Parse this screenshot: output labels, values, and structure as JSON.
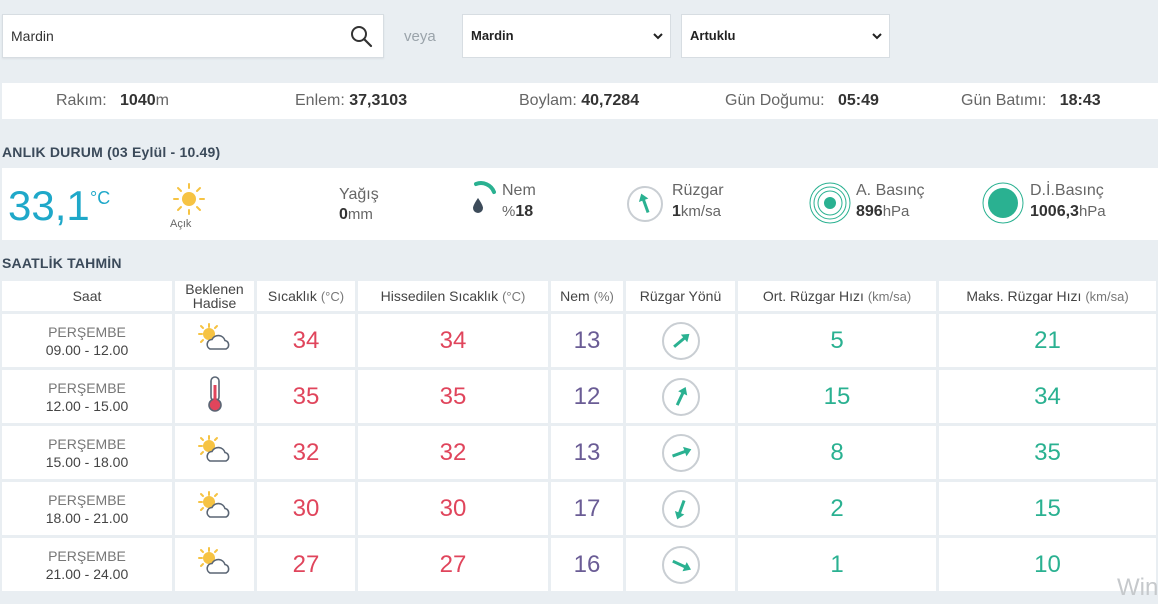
{
  "search": {
    "value": "Mardin",
    "placeholder": ""
  },
  "or_label": "veya",
  "province_select": {
    "selected": "Mardin"
  },
  "district_select": {
    "selected": "Artuklu"
  },
  "info": {
    "altitude_label": "Rakım:",
    "altitude_value": "1040",
    "altitude_unit": "m",
    "lat_label": "Enlem:",
    "lat_value": "37,3103",
    "lon_label": "Boylam:",
    "lon_value": "40,7284",
    "sunrise_label": "Gün Doğumu:",
    "sunrise_value": "05:49",
    "sunset_label": "Gün Batımı:",
    "sunset_value": "18:43"
  },
  "current": {
    "section_title": "ANLIK DURUM",
    "section_date": "(03 Eylül - 10.49)",
    "temperature": "33,1",
    "temperature_unit": "°C",
    "sky_label": "Açık",
    "rain_label": "Yağış",
    "rain_value": "0",
    "rain_unit": "mm",
    "humidity_label": "Nem",
    "humidity_prefix": "%",
    "humidity_value": "18",
    "wind_label": "Rüzgar",
    "wind_value": "1",
    "wind_unit": "km/sa",
    "pressure_label": "A. Basınç",
    "pressure_value": "896",
    "pressure_unit": "hPa",
    "sea_pressure_label": "D.İ.Basınç",
    "sea_pressure_value": "1006,3",
    "sea_pressure_unit": "hPa",
    "colors": {
      "temperature": "#1fa8c9",
      "accent": "#2ab191"
    }
  },
  "hourly": {
    "section_title": "SAATLİK TAHMİN",
    "headers": {
      "time": "Saat",
      "event_line1": "Beklenen",
      "event_line2": "Hadise",
      "temp": "Sıcaklık",
      "temp_unit": "(°C)",
      "feels": "Hissedilen Sıcaklık",
      "feels_unit": "(°C)",
      "humidity": "Nem",
      "humidity_unit": "(%)",
      "wind_dir": "Rüzgar Yönü",
      "avg_wind": "Ort. Rüzgar Hızı",
      "avg_wind_unit": "(km/sa)",
      "max_wind": "Maks. Rüzgar Hızı",
      "max_wind_unit": "(km/sa)"
    },
    "rows": [
      {
        "day": "PERŞEMBE",
        "hours": "09.00 - 12.00",
        "icon": "partly-sunny-icon",
        "temp": "34",
        "feels": "34",
        "humidity": "13",
        "wind_dir_deg": 50,
        "avg_wind": "5",
        "max_wind": "21"
      },
      {
        "day": "PERŞEMBE",
        "hours": "12.00 - 15.00",
        "icon": "thermometer-hot-icon",
        "temp": "35",
        "feels": "35",
        "humidity": "12",
        "wind_dir_deg": 25,
        "avg_wind": "15",
        "max_wind": "34"
      },
      {
        "day": "PERŞEMBE",
        "hours": "15.00 - 18.00",
        "icon": "partly-sunny-icon",
        "temp": "32",
        "feels": "32",
        "humidity": "13",
        "wind_dir_deg": 70,
        "avg_wind": "8",
        "max_wind": "35"
      },
      {
        "day": "PERŞEMBE",
        "hours": "18.00 - 21.00",
        "icon": "partly-sunny-icon",
        "temp": "30",
        "feels": "30",
        "humidity": "17",
        "wind_dir_deg": 200,
        "avg_wind": "2",
        "max_wind": "15"
      },
      {
        "day": "PERŞEMBE",
        "hours": "21.00 - 24.00",
        "icon": "partly-sunny-icon",
        "temp": "27",
        "feels": "27",
        "humidity": "16",
        "wind_dir_deg": 115,
        "avg_wind": "1",
        "max_wind": "10"
      }
    ]
  },
  "watermark_text": "Win"
}
